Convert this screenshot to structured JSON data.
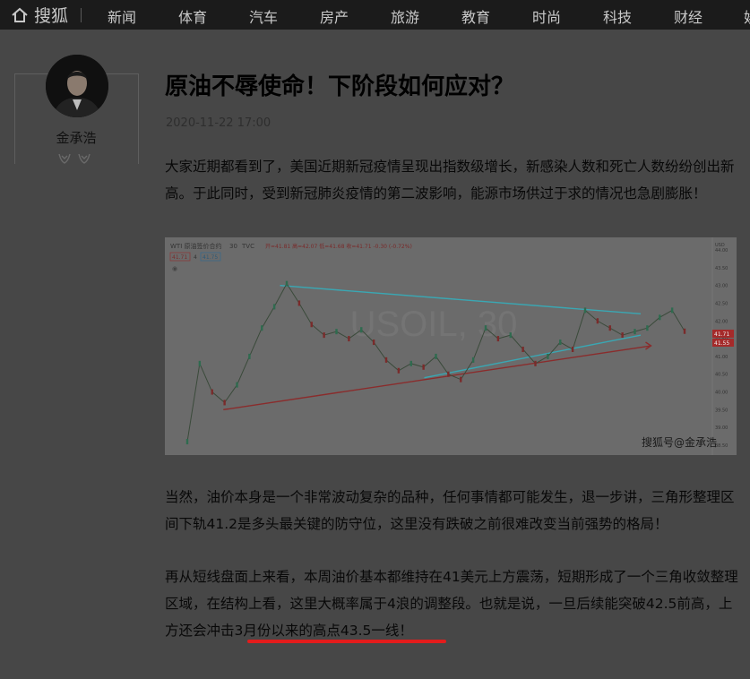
{
  "nav": {
    "logo_text": "搜狐",
    "items": [
      "新闻",
      "体育",
      "汽车",
      "房产",
      "旅游",
      "教育",
      "时尚",
      "科技",
      "财经",
      "娱"
    ]
  },
  "author": {
    "name": "金承浩"
  },
  "article": {
    "title": "原油不辱使命！下阶段如何应对？",
    "date": "2020-11-22 17:00",
    "para1": "大家近期都看到了，美国近期新冠疫情呈现出指数级增长，新感染人数和死亡人数纷纷创出新高。于此同时，受到新冠肺炎疫情的第二波影响，能源市场供过于求的情况也急剧膨胀！",
    "para2": "当然，油价本身是一个非常波动复杂的品种，任何事情都可能发生，退一步讲，三角形整理区间下轨41.2是多头最关键的防守位，这里没有跌破之前很难改变当前强势的格局！",
    "para3": "再从短线盘面上来看，本周油价基本都维持在41美元上方震荡，短期形成了一个三角收敛整理区域，在结构上看，这里大概率属于4浪的调整段。也就是说，一旦后续能突破42.5前高，上方还会冲击3月份以来的高点43.5一线！"
  },
  "chart_data": {
    "type": "line",
    "title": "WTI 原油签价合约",
    "interval": "30",
    "source_label": "TVC",
    "watermark": "USOIL, 30",
    "ohlc_label": "开=41.81 高=42.07 低=41.68 收=41.71 -0.30 (-0.72%)",
    "price_boxes": [
      "41.71",
      "4",
      "41.75"
    ],
    "credit": "搜狐号@金承浩",
    "currency": "USD",
    "yticks": [
      "44.00",
      "43.50",
      "43.00",
      "42.50",
      "42.00",
      "41.50",
      "41.00",
      "40.50",
      "40.00",
      "39.50",
      "39.00",
      "38.50"
    ],
    "ylim": [
      38.5,
      44.0
    ],
    "last_price": "41.71",
    "last_price_tag": "41.55",
    "series": [
      {
        "values": [
          38.6,
          40.8,
          40.0,
          39.7,
          40.2,
          41.0,
          41.8,
          42.4,
          43.05,
          42.5,
          41.9,
          41.6,
          41.7,
          41.5,
          41.75,
          41.4,
          40.9,
          40.6,
          40.8,
          40.7,
          41.0,
          40.5,
          40.35,
          40.9,
          41.8,
          41.5,
          41.6,
          41.2,
          40.8,
          41.0,
          41.4,
          41.2,
          42.3,
          42.0,
          41.8,
          41.6,
          41.7,
          41.8,
          42.1,
          42.3,
          41.71
        ]
      }
    ],
    "trendlines": [
      {
        "name": "upper",
        "color": "#3aa7b3",
        "from": [
          0.18,
          43.0
        ],
        "to": [
          0.88,
          42.2
        ]
      },
      {
        "name": "lower",
        "color": "#3aa7b3",
        "from": [
          0.46,
          40.4
        ],
        "to": [
          0.88,
          41.6
        ]
      },
      {
        "name": "support",
        "color": "#8a2c2c",
        "from": [
          0.07,
          39.5
        ],
        "to": [
          0.9,
          41.3
        ]
      }
    ]
  }
}
